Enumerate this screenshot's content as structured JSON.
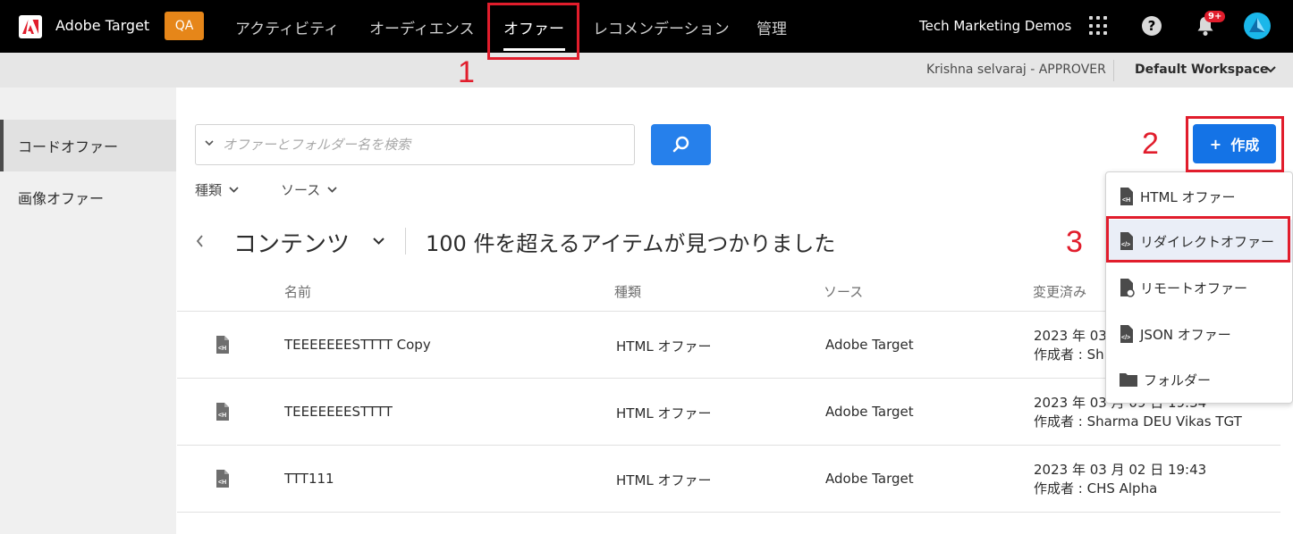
{
  "topbar": {
    "app_name": "Adobe Target",
    "env_badge": "QA",
    "nav": [
      {
        "label": "アクティビティ"
      },
      {
        "label": "オーディエンス"
      },
      {
        "label": "オファー"
      },
      {
        "label": "レコメンデーション"
      },
      {
        "label": "管理"
      }
    ],
    "org_name": "Tech Marketing Demos",
    "help_label": "?",
    "notification_count": "9+",
    "icons": [
      "app-grid-icon",
      "help-icon",
      "bell-icon",
      "avatar"
    ]
  },
  "subbar": {
    "user_role": "Krishna selvaraj - APPROVER",
    "workspace": "Default Workspace"
  },
  "sidebar": {
    "items": [
      {
        "label": "コードオファー"
      },
      {
        "label": "画像オファー"
      }
    ]
  },
  "search": {
    "placeholder": "オファーとフォルダー名を検索"
  },
  "filters": {
    "type_label": "種類",
    "source_label": "ソース"
  },
  "breadcrumb": {
    "title": "コンテンツ",
    "result_count": "100 件を超えるアイテムが見つかりました"
  },
  "table": {
    "columns": [
      "名前",
      "種類",
      "ソース",
      "変更済み"
    ],
    "rows": [
      {
        "name": "TEEEEEEESTTTT Copy",
        "type": "HTML オファー",
        "source": "Adobe Target",
        "date": "2023 年 03",
        "author": "作成者 : Sh"
      },
      {
        "name": "TEEEEEEESTTTT",
        "type": "HTML オファー",
        "source": "Adobe Target",
        "date": "2023 年 03 月 09 日 19:34",
        "author": "作成者 : Sharma DEU Vikas TGT"
      },
      {
        "name": "TTT111",
        "type": "HTML オファー",
        "source": "Adobe Target",
        "date": "2023 年 03 月 02 日 19:43",
        "author": "作成者 : CHS Alpha"
      }
    ]
  },
  "create_button": {
    "plus": "+",
    "label": "作成"
  },
  "create_menu": {
    "items": [
      {
        "label": "HTML オファー",
        "icon": "html-file-icon"
      },
      {
        "label": "リダイレクトオファー",
        "icon": "redirect-file-icon"
      },
      {
        "label": "リモートオファー",
        "icon": "remote-file-icon"
      },
      {
        "label": "JSON オファー",
        "icon": "json-file-icon"
      },
      {
        "label": "フォルダー",
        "icon": "folder-icon"
      }
    ]
  },
  "annotations": [
    "1",
    "2",
    "3"
  ],
  "colors": {
    "topbar": "#000000",
    "accent": "#1473e6",
    "search_button": "#2680eb",
    "env_badge": "#e68619",
    "annotation": "#e11d2c",
    "notification": "#e11d2c"
  }
}
